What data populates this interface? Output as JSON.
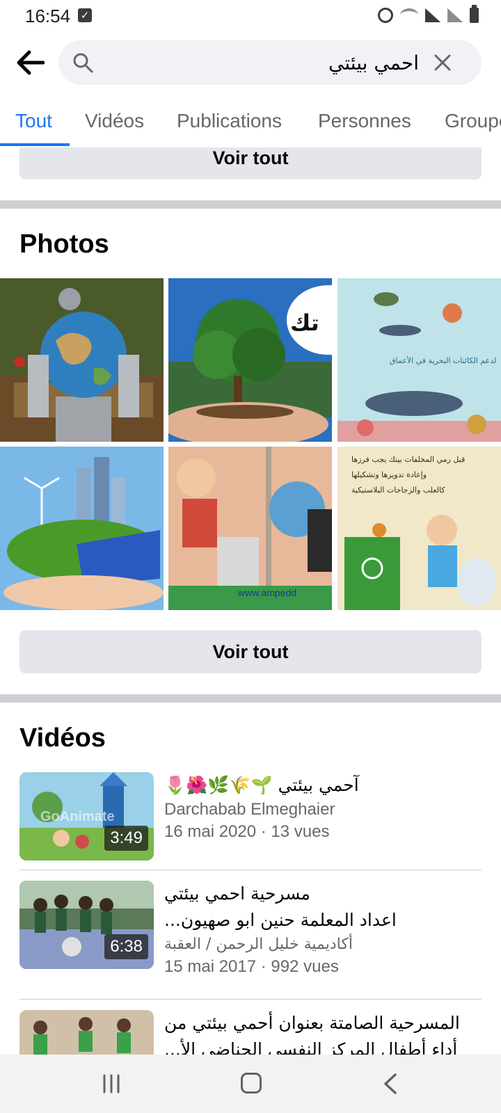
{
  "status_bar": {
    "time": "16:54"
  },
  "search": {
    "query": "احمي بيئتي"
  },
  "tabs": [
    {
      "label": "Tout",
      "active": true
    },
    {
      "label": "Vidéos",
      "active": false
    },
    {
      "label": "Publications",
      "active": false
    },
    {
      "label": "Personnes",
      "active": false
    },
    {
      "label": "Groupes",
      "active": false
    }
  ],
  "top_see_all": "Voir tout",
  "photos": {
    "title": "Photos",
    "see_all": "Voir tout"
  },
  "videos": {
    "title": "Vidéos",
    "items": [
      {
        "title": "آحمي بيئتي 🌱🌾🌿🌺🌷",
        "channel": "Darchabab Elmeghaier",
        "meta": "16 mai 2020 · 13 vues",
        "duration": "3:49"
      },
      {
        "title": "مسرحية احمي بيئتي",
        "title_line2": "اعداد المعلمة حنين ابو صهيون...",
        "channel": "أكاديمية خليل الرحمن / العقبة",
        "meta": "15 mai 2017 · 992 vues",
        "duration": "6:38"
      },
      {
        "title": "المسرحية الصامتة بعنوان أحمي بيئتي من",
        "title_line2": "أداء أطفال المركز النفسي الحناضي الأ..."
      }
    ]
  },
  "colors": {
    "accent": "#1877f2",
    "button_bg": "#e4e6eb",
    "muted": "#65676b"
  }
}
